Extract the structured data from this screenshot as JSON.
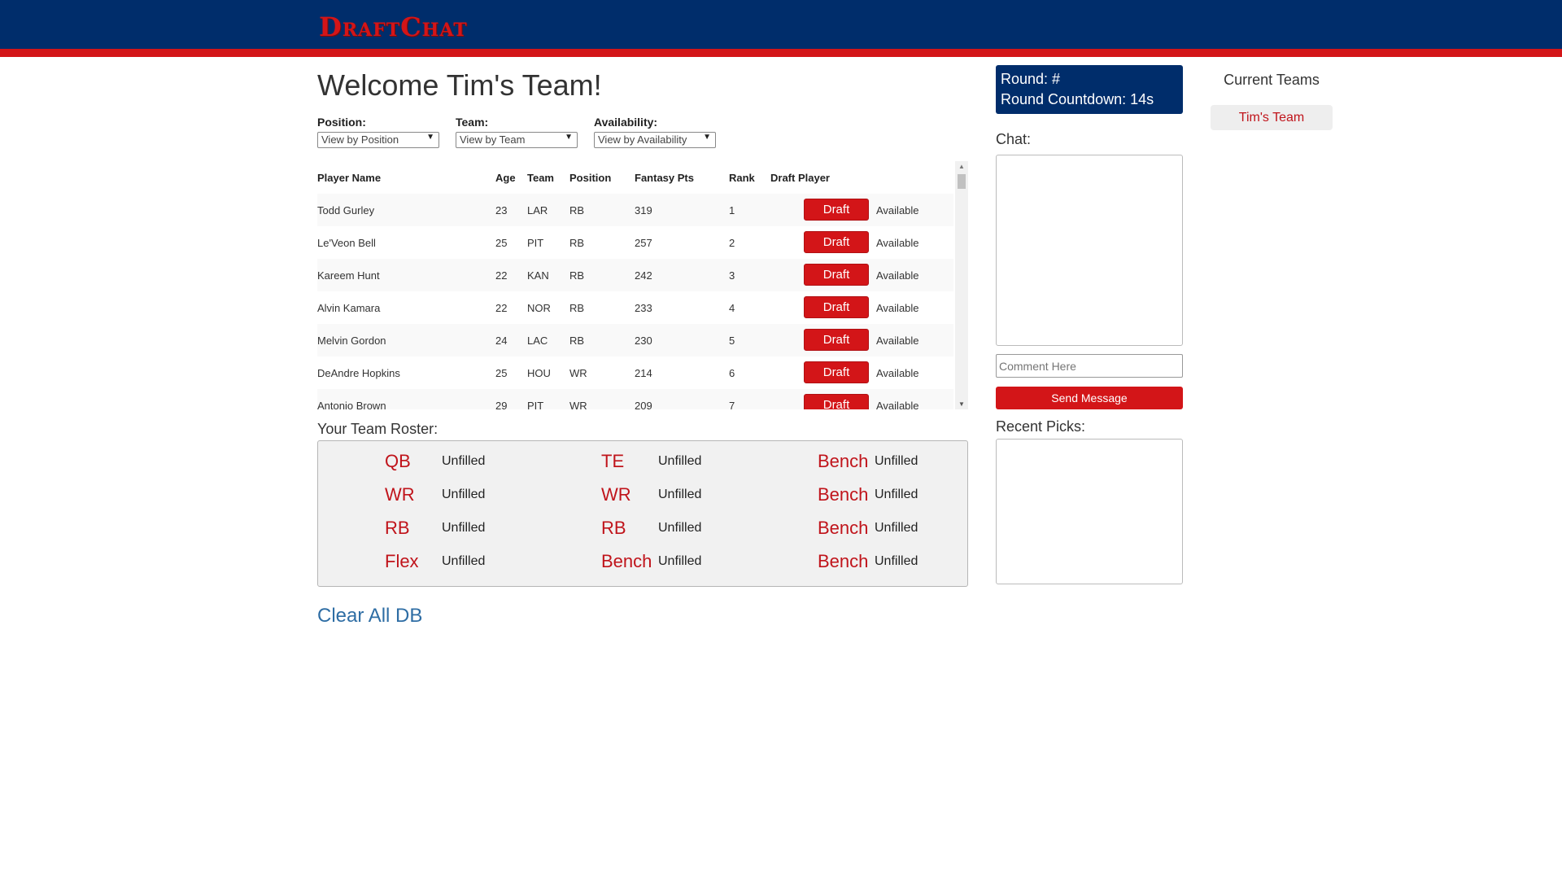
{
  "header": {
    "logo": "DraftChat"
  },
  "welcome": "Welcome Tim's Team!",
  "filters": [
    {
      "label": "Position:",
      "value": "View by Position"
    },
    {
      "label": "Team:",
      "value": "View by Team"
    },
    {
      "label": "Availability:",
      "value": "View by Availability"
    }
  ],
  "table": {
    "headers": [
      "Player Name",
      "Age",
      "Team",
      "Position",
      "Fantasy Pts",
      "Rank",
      "Draft Player"
    ],
    "rows": [
      {
        "name": "Todd Gurley",
        "age": "23",
        "team": "LAR",
        "pos": "RB",
        "pts": "319",
        "rank": "1",
        "button": "Draft",
        "status": "Available"
      },
      {
        "name": "Le'Veon Bell",
        "age": "25",
        "team": "PIT",
        "pos": "RB",
        "pts": "257",
        "rank": "2",
        "button": "Draft",
        "status": "Available"
      },
      {
        "name": "Kareem Hunt",
        "age": "22",
        "team": "KAN",
        "pos": "RB",
        "pts": "242",
        "rank": "3",
        "button": "Draft",
        "status": "Available"
      },
      {
        "name": "Alvin Kamara",
        "age": "22",
        "team": "NOR",
        "pos": "RB",
        "pts": "233",
        "rank": "4",
        "button": "Draft",
        "status": "Available"
      },
      {
        "name": "Melvin Gordon",
        "age": "24",
        "team": "LAC",
        "pos": "RB",
        "pts": "230",
        "rank": "5",
        "button": "Draft",
        "status": "Available"
      },
      {
        "name": "DeAndre Hopkins",
        "age": "25",
        "team": "HOU",
        "pos": "WR",
        "pts": "214",
        "rank": "6",
        "button": "Draft",
        "status": "Available"
      },
      {
        "name": "Antonio Brown",
        "age": "29",
        "team": "PIT",
        "pos": "WR",
        "pts": "209",
        "rank": "7",
        "button": "Draft",
        "status": "Available"
      }
    ]
  },
  "roster": {
    "title": "Your Team Roster:",
    "slots": [
      {
        "pos": "QB",
        "value": "Unfilled"
      },
      {
        "pos": "TE",
        "value": "Unfilled"
      },
      {
        "pos": "Bench",
        "value": "Unfilled"
      },
      {
        "pos": "WR",
        "value": "Unfilled"
      },
      {
        "pos": "WR",
        "value": "Unfilled"
      },
      {
        "pos": "Bench",
        "value": "Unfilled"
      },
      {
        "pos": "RB",
        "value": "Unfilled"
      },
      {
        "pos": "RB",
        "value": "Unfilled"
      },
      {
        "pos": "Bench",
        "value": "Unfilled"
      },
      {
        "pos": "Flex",
        "value": "Unfilled"
      },
      {
        "pos": "Bench",
        "value": "Unfilled"
      },
      {
        "pos": "Bench",
        "value": "Unfilled"
      }
    ]
  },
  "clear_db": "Clear All DB",
  "round": {
    "round_text": "Round: #",
    "countdown_text": "Round Countdown: 14s"
  },
  "chat": {
    "label": "Chat:",
    "placeholder": "Comment Here",
    "send_label": "Send Message"
  },
  "recent_picks": {
    "label": "Recent Picks:"
  },
  "teams": {
    "title": "Current Teams",
    "items": [
      "Tim's Team"
    ]
  },
  "colors": {
    "navy": "#002d6b",
    "red": "#d31518",
    "link": "#2e6da4"
  }
}
